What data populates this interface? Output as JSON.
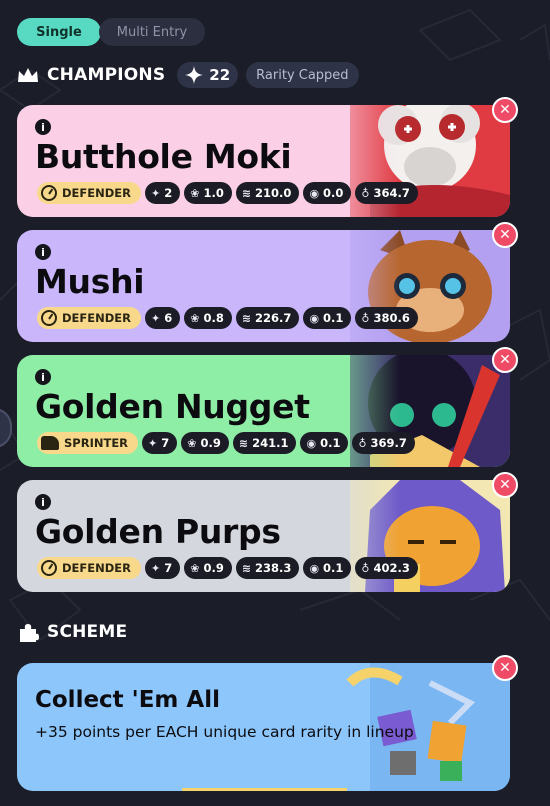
{
  "mode_tabs": {
    "single": "Single",
    "multi": "Multi Entry"
  },
  "champions": {
    "title": "CHAMPIONS",
    "count": "22",
    "rarity_label": "Rarity Capped"
  },
  "cards": [
    {
      "name": "Butthole Moki",
      "role": "DEFENDER",
      "stats": [
        "2",
        "1.0",
        "210.0",
        "0.0",
        "364.7"
      ],
      "bg": "#fbd0e6",
      "art": "#e85a55"
    },
    {
      "name": "Mushi",
      "role": "DEFENDER",
      "stats": [
        "6",
        "0.8",
        "226.7",
        "0.1",
        "380.6"
      ],
      "bg": "#c9b6fb",
      "art": "#c06d3b"
    },
    {
      "name": "Golden Nugget",
      "role": "SPRINTER",
      "stats": [
        "7",
        "0.9",
        "241.1",
        "0.1",
        "369.7"
      ],
      "bg": "#8feea5",
      "art": "#1d1730"
    },
    {
      "name": "Golden Purps",
      "role": "DEFENDER",
      "stats": [
        "7",
        "0.9",
        "238.3",
        "0.1",
        "402.3"
      ],
      "bg": "#d4d8de",
      "art": "#f0a232"
    }
  ],
  "scheme": {
    "title": "SCHEME",
    "card_title": "Collect 'Em All",
    "card_desc": "+35 points per EACH unique card rarity in lineup"
  },
  "icons": {
    "crown": "crown-icon",
    "gem": "gem-icon",
    "puzzle": "puzzle-icon",
    "info": "info-icon",
    "close": "close-icon"
  },
  "colors": {
    "accent": "#57d9c2",
    "remove": "#ef4b66",
    "role_chip": "#f8d98c",
    "scheme_bg": "#8dc6fb"
  }
}
